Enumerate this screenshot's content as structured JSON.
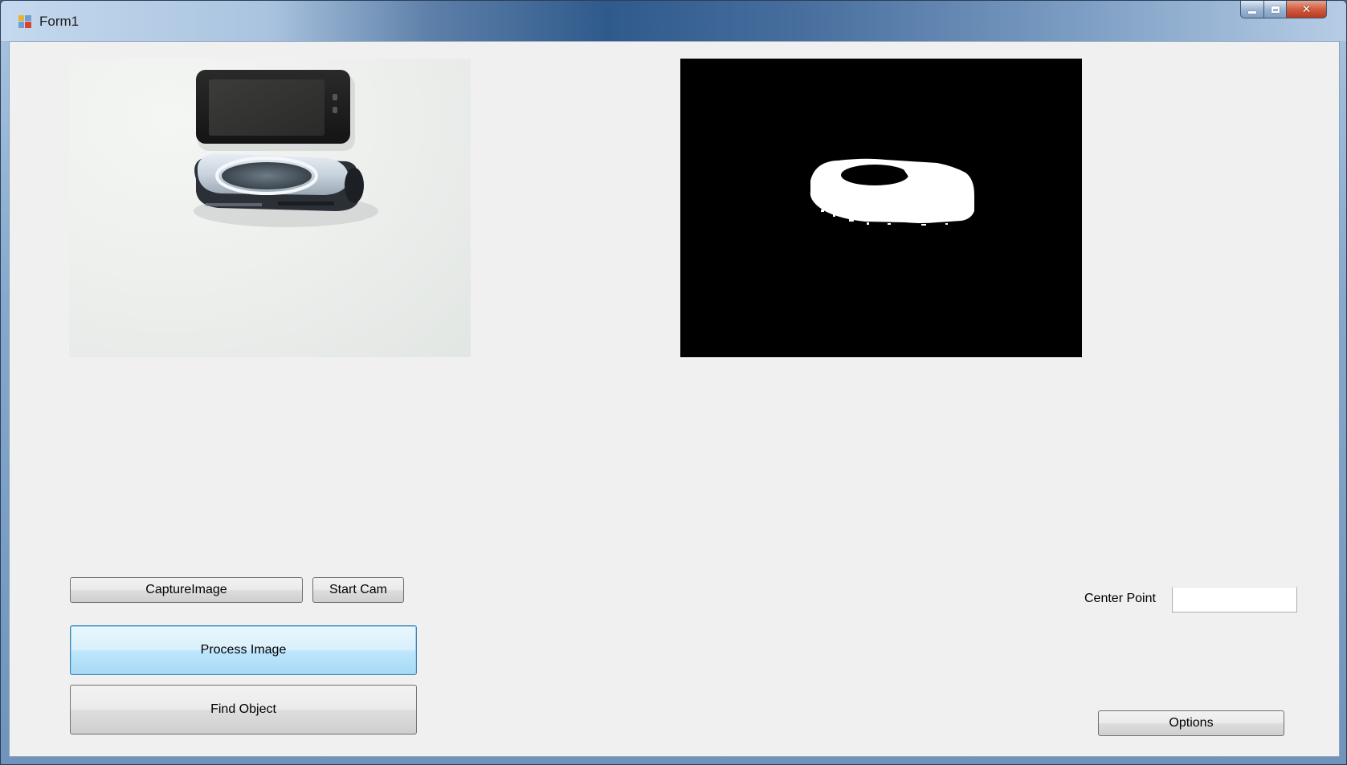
{
  "window": {
    "title": "Form1",
    "icon": "winforms-app-icon",
    "controls": [
      "minimize-icon",
      "maximize-icon",
      "close-icon"
    ]
  },
  "images": {
    "source": "camera-capture-image",
    "processed": "binary-threshold-image"
  },
  "buttons": {
    "capture_image": "CaptureImage",
    "start_cam": "Start Cam",
    "process_image": "Process Image",
    "find_object": "Find Object",
    "options": "Options"
  },
  "center_point": {
    "label": "Center Point",
    "value": ""
  },
  "colors": {
    "form_background": "#f0f0f0",
    "focused_button_border": "#3c7fb1",
    "processed_background": "#000000",
    "processed_foreground": "#ffffff"
  }
}
